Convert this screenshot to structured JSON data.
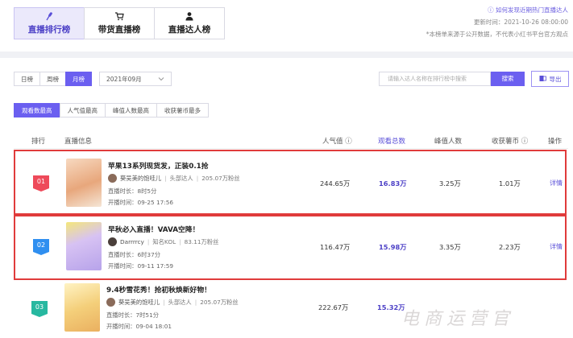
{
  "tabs": [
    {
      "label": "直播排行榜",
      "icon": "mic-icon"
    },
    {
      "label": "带货直播榜",
      "icon": "cart-icon"
    },
    {
      "label": "直播达人榜",
      "icon": "person-icon"
    }
  ],
  "info": {
    "link": "ⓘ 如何发现近期热门直播达人",
    "updated": "更新时间：2021-10-26 08:00:00",
    "note": "*本榜单来源于公开数据，不代表小红书平台官方观点"
  },
  "period_tabs": [
    {
      "label": "日榜",
      "active": false
    },
    {
      "label": "周榜",
      "active": false
    },
    {
      "label": "月榜",
      "active": true
    }
  ],
  "date_select": "2021年09月",
  "search": {
    "placeholder": "请输入达人名称在排行榜中搜索",
    "button": "搜索"
  },
  "export_label": "导出",
  "metric_tabs": [
    {
      "label": "观看数最高",
      "active": true
    },
    {
      "label": "人气值最高",
      "active": false
    },
    {
      "label": "峰值人数最高",
      "active": false
    },
    {
      "label": "收获薯币最多",
      "active": false
    }
  ],
  "columns": {
    "rank": "排行",
    "info": "直播信息",
    "popularity": "人气值 ⓘ",
    "views": "观看总数",
    "peak": "峰值人数",
    "coins": "收获薯币 ⓘ",
    "action": "操作"
  },
  "rows": [
    {
      "rank": "01",
      "title": "苹果13系列现货发，正装0.1抢",
      "author": "葵吴美的饱哇儿",
      "author_type": "头部达人",
      "fans": "205.07万粉丝",
      "duration": "直播时长：8时5分",
      "start": "开播时间：09-25 17:56",
      "popularity": "244.65万",
      "views": "16.83万",
      "peak": "3.25万",
      "coins": "1.01万",
      "action": "详情",
      "badge_color": "#ee4a5a",
      "thumb_color": "#f2c9a6",
      "selected": true
    },
    {
      "rank": "02",
      "title": "早秋必入直播！VAVA空降！",
      "author": "Darrrrcy",
      "author_type": "知名KOL",
      "fans": "83.11万粉丝",
      "duration": "直播时长：6时37分",
      "start": "开播时间：09-11 17:59",
      "popularity": "116.47万",
      "views": "15.98万",
      "peak": "3.35万",
      "coins": "2.23万",
      "action": "详情",
      "badge_color": "#2f8ff0",
      "thumb_color": "#c9b8f2",
      "selected": true
    },
    {
      "rank": "03",
      "title": "9.4秒雪花秀！抢初秋焕新好物！",
      "author": "葵吴美的饱哇儿",
      "author_type": "头部达人",
      "fans": "205.07万粉丝",
      "duration": "直播时长：7时51分",
      "start": "开播时间：09-04 18:01",
      "popularity": "222.67万",
      "views": "15.32万",
      "peak": "",
      "coins": "",
      "action": "",
      "badge_color": "#27b8a0",
      "thumb_color": "#f4d79a",
      "selected": false
    }
  ],
  "watermark": "电商运营官"
}
